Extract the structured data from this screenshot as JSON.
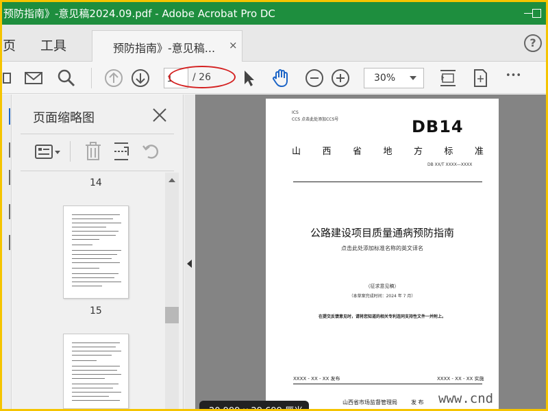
{
  "window": {
    "title": "预防指南》-意见稿2024.09.pdf - Adobe Acrobat Pro DC"
  },
  "menu": {
    "home": "主页",
    "tools": "工具"
  },
  "tab": {
    "label": "预防指南》-意见稿...",
    "close": "×"
  },
  "toolbar": {
    "page_current": "1",
    "page_total": "/ 26",
    "zoom": "30%",
    "more": "•••"
  },
  "thumbnail_panel": {
    "title": "页面缩略图",
    "pages": [
      {
        "number": "14"
      },
      {
        "number": "15"
      }
    ]
  },
  "document": {
    "ics": "ICS",
    "ccs": "CCS  点击此处添加CCS号",
    "db_mark": "DB14",
    "region": [
      "山",
      "西",
      "省",
      "地",
      "方",
      "标",
      "准"
    ],
    "standard_code": "DB XX/T  XXXX—XXXX",
    "title": "公路建设项目质量通病预防指南",
    "english_name_hint": "点击此处添加标准名称的英文译名",
    "draft_label": "（征求意见稿）",
    "completion": "（本草案完成时间：2024 年 7 月）",
    "feedback_note": "在提交反馈意见时，请将您知道的相关专利连同支持性文件一并附上。",
    "publish_date": "XXXX - XX - XX 发布",
    "implement_date": "XXXX - XX - XX 实施",
    "issuer": "山西省市场监督管理局",
    "issue_word": "发 布"
  },
  "status": {
    "page_size": "20.999 x 29.699 厘米"
  },
  "watermark": "www.cnd",
  "colors": {
    "titlebar": "#1e8e3e",
    "frame": "#f5c400",
    "annotation": "#d42020",
    "hand_tool": "#1a63c6"
  }
}
